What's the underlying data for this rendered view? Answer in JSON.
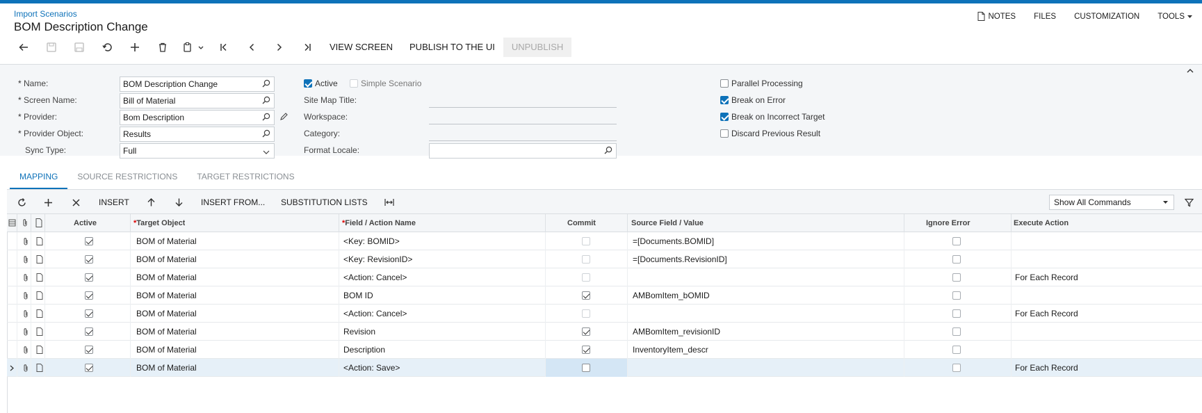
{
  "breadcrumb": "Import Scenarios",
  "title": "BOM Description Change",
  "right_menu": {
    "notes": "NOTES",
    "files": "FILES",
    "customization": "CUSTOMIZATION",
    "tools": "TOOLS"
  },
  "toolbar": {
    "view_screen": "VIEW SCREEN",
    "publish": "PUBLISH TO THE UI",
    "unpublish": "UNPUBLISH"
  },
  "form": {
    "name_label": "Name:",
    "name_value": "BOM Description Change",
    "screen_label": "Screen Name:",
    "screen_value": "Bill of Material",
    "provider_label": "Provider:",
    "provider_value": "Bom Description",
    "provider_object_label": "Provider Object:",
    "provider_object_value": "Results",
    "sync_type_label": "Sync Type:",
    "sync_type_value": "Full",
    "active_label": "Active",
    "simple_label": "Simple Scenario",
    "site_map_label": "Site Map Title:",
    "workspace_label": "Workspace:",
    "category_label": "Category:",
    "format_locale_label": "Format Locale:",
    "parallel_label": "Parallel Processing",
    "break_error_label": "Break on Error",
    "break_target_label": "Break on Incorrect Target",
    "discard_label": "Discard Previous Result",
    "checks": {
      "active": true,
      "simple": false,
      "parallel": false,
      "break_error": true,
      "break_target": true,
      "discard": false
    }
  },
  "tabs": [
    "MAPPING",
    "SOURCE RESTRICTIONS",
    "TARGET RESTRICTIONS"
  ],
  "grid_toolbar": {
    "insert": "INSERT",
    "insert_from": "INSERT FROM...",
    "substitution": "SUBSTITUTION LISTS",
    "command_filter": "Show All Commands"
  },
  "columns": {
    "active": "Active",
    "target": "Target Object",
    "field": "Field / Action Name",
    "commit": "Commit",
    "source": "Source Field / Value",
    "ignore": "Ignore Error",
    "execute": "Execute Action"
  },
  "rows": [
    {
      "active": true,
      "target": "BOM of Material",
      "field": "<Key: BOMID>",
      "commit": false,
      "commit_dis": true,
      "source": "=[Documents.BOMID]",
      "ignore": false,
      "execute": ""
    },
    {
      "active": true,
      "target": "BOM of Material",
      "field": "<Key: RevisionID>",
      "commit": false,
      "commit_dis": true,
      "source": "=[Documents.RevisionID]",
      "ignore": false,
      "execute": ""
    },
    {
      "active": true,
      "target": "BOM of Material",
      "field": "<Action: Cancel>",
      "commit": false,
      "commit_dis": true,
      "source": "",
      "ignore": false,
      "execute": "For Each Record"
    },
    {
      "active": true,
      "target": "BOM of Material",
      "field": "BOM ID",
      "commit": true,
      "commit_dis": false,
      "source": "AMBomItem_bOMID",
      "ignore": false,
      "execute": ""
    },
    {
      "active": true,
      "target": "BOM of Material",
      "field": "<Action: Cancel>",
      "commit": false,
      "commit_dis": true,
      "source": "",
      "ignore": false,
      "execute": "For Each Record"
    },
    {
      "active": true,
      "target": "BOM of Material",
      "field": "Revision",
      "commit": true,
      "commit_dis": false,
      "source": "AMBomItem_revisionID",
      "ignore": false,
      "execute": ""
    },
    {
      "active": true,
      "target": "BOM of Material",
      "field": "Description",
      "commit": true,
      "commit_dis": false,
      "source": "InventoryItem_descr",
      "ignore": false,
      "execute": ""
    },
    {
      "active": true,
      "target": "BOM of Material",
      "field": "<Action: Save>",
      "commit": false,
      "commit_dis": false,
      "source": "",
      "ignore": false,
      "execute": "For Each Record",
      "selected": true
    }
  ]
}
